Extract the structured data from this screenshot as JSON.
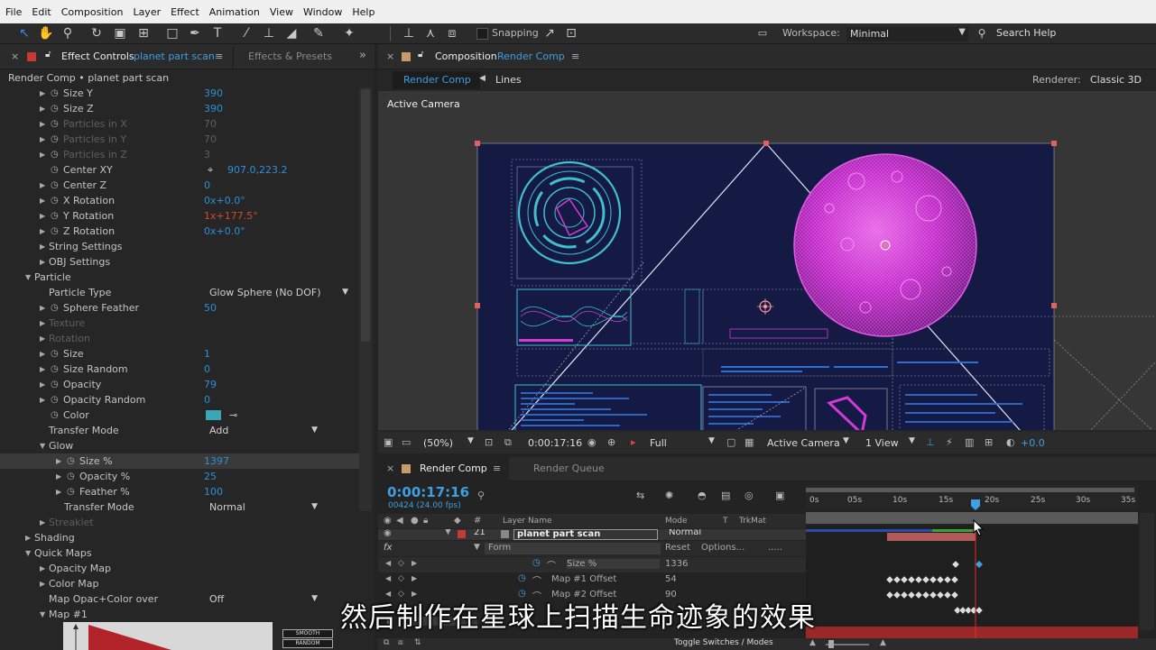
{
  "menu": [
    "File",
    "Edit",
    "Composition",
    "Layer",
    "Effect",
    "Animation",
    "View",
    "Window",
    "Help"
  ],
  "toolbar": {
    "snapping_label": "Snapping",
    "workspace_label": "Workspace:",
    "workspace_value": "Minimal",
    "search_help": "Search Help"
  },
  "effect_controls": {
    "tab_prefix": "Effect Controls",
    "layer_name": "planet part scan",
    "tab2": "Effects & Presets",
    "breadcrumb": "Render Comp • planet part scan",
    "rows": [
      {
        "label": "Size Y",
        "value": "390",
        "indent": 1,
        "tri": "▶",
        "sw": true,
        "state": "normal"
      },
      {
        "label": "Size Z",
        "value": "390",
        "indent": 1,
        "tri": "▶",
        "sw": true,
        "state": "normal"
      },
      {
        "label": "Particles in X",
        "value": "70",
        "indent": 1,
        "tri": "▶",
        "sw": true,
        "state": "dim"
      },
      {
        "label": "Particles in Y",
        "value": "70",
        "indent": 1,
        "tri": "▶",
        "sw": true,
        "state": "dim"
      },
      {
        "label": "Particles in Z",
        "value": "3",
        "indent": 1,
        "tri": "▶",
        "sw": true,
        "state": "dim"
      },
      {
        "label": "Center XY",
        "value": "907.0,223.2",
        "indent": 1,
        "tri": "",
        "sw": true,
        "state": "point"
      },
      {
        "label": "Center Z",
        "value": "0",
        "indent": 1,
        "tri": "▶",
        "sw": true,
        "state": "normal"
      },
      {
        "label": "X Rotation",
        "value": "0x+0.0°",
        "indent": 1,
        "tri": "▶",
        "sw": true,
        "state": "normal"
      },
      {
        "label": "Y Rotation",
        "value": "1x+177.5°",
        "indent": 1,
        "tri": "▶",
        "sw": true,
        "state": "red"
      },
      {
        "label": "Z Rotation",
        "value": "0x+0.0°",
        "indent": 1,
        "tri": "▶",
        "sw": true,
        "state": "normal"
      },
      {
        "label": "String Settings",
        "value": "",
        "indent": 1,
        "tri": "▶",
        "sw": false,
        "state": "normal"
      },
      {
        "label": "OBJ Settings",
        "value": "",
        "indent": 1,
        "tri": "▶",
        "sw": false,
        "state": "normal"
      },
      {
        "label": "Particle",
        "value": "",
        "indent": 0,
        "tri": "▼",
        "sw": false,
        "state": "normal"
      },
      {
        "label": "Particle Type",
        "value": "",
        "indent": 2,
        "tri": "",
        "sw": false,
        "state": "dd",
        "dd": "Glow Sphere (No DOF)"
      },
      {
        "label": "Sphere Feather",
        "value": "50",
        "indent": 1,
        "tri": "▶",
        "sw": true,
        "state": "normal"
      },
      {
        "label": "Texture",
        "value": "",
        "indent": 1,
        "tri": "▶",
        "sw": false,
        "state": "dim"
      },
      {
        "label": "Rotation",
        "value": "",
        "indent": 1,
        "tri": "▶",
        "sw": false,
        "state": "dim"
      },
      {
        "label": "Size",
        "value": "1",
        "indent": 1,
        "tri": "▶",
        "sw": true,
        "state": "normal"
      },
      {
        "label": "Size Random",
        "value": "0",
        "indent": 1,
        "tri": "▶",
        "sw": true,
        "state": "normal"
      },
      {
        "label": "Opacity",
        "value": "79",
        "indent": 1,
        "tri": "▶",
        "sw": true,
        "state": "normal"
      },
      {
        "label": "Opacity Random",
        "value": "0",
        "indent": 1,
        "tri": "▶",
        "sw": true,
        "state": "normal"
      },
      {
        "label": "Color",
        "value": "",
        "indent": 1,
        "tri": "",
        "sw": true,
        "state": "color"
      },
      {
        "label": "Transfer Mode",
        "value": "",
        "indent": 2,
        "tri": "",
        "sw": false,
        "state": "dd",
        "dd": "Add"
      },
      {
        "label": "Glow",
        "value": "",
        "indent": 1,
        "tri": "▼",
        "sw": false,
        "state": "normal"
      },
      {
        "label": "Size %",
        "value": "1397",
        "indent": 3,
        "tri": "▶",
        "sw": true,
        "state": "sel"
      },
      {
        "label": "Opacity %",
        "value": "25",
        "indent": 3,
        "tri": "▶",
        "sw": true,
        "state": "normal"
      },
      {
        "label": "Feather %",
        "value": "100",
        "indent": 3,
        "tri": "▶",
        "sw": true,
        "state": "normal"
      },
      {
        "label": "Transfer Mode",
        "value": "",
        "indent": 4,
        "tri": "",
        "sw": false,
        "state": "dd",
        "dd": "Normal"
      },
      {
        "label": "Streaklet",
        "value": "",
        "indent": 1,
        "tri": "▶",
        "sw": false,
        "state": "dim"
      },
      {
        "label": "Shading",
        "value": "",
        "indent": 0,
        "tri": "▶",
        "sw": false,
        "state": "normal"
      },
      {
        "label": "Quick Maps",
        "value": "",
        "indent": 0,
        "tri": "▼",
        "sw": false,
        "state": "normal"
      },
      {
        "label": "Opacity Map",
        "value": "",
        "indent": 1,
        "tri": "▶",
        "sw": false,
        "state": "normal"
      },
      {
        "label": "Color Map",
        "value": "",
        "indent": 1,
        "tri": "▶",
        "sw": false,
        "state": "normal"
      },
      {
        "label": "Map Opac+Color over",
        "value": "",
        "indent": 2,
        "tri": "",
        "sw": false,
        "state": "dd",
        "dd": "Off"
      },
      {
        "label": "Map #1",
        "value": "",
        "indent": 1,
        "tri": "▼",
        "sw": false,
        "state": "normal"
      }
    ],
    "smooth_label": "SMOOTH",
    "random_label": "RANDOM",
    "color_swatch": "#3aa7b8"
  },
  "composition": {
    "tab_prefix": "Composition",
    "comp_name": "Render Comp",
    "crumb_active": "Render Comp",
    "crumb_next": "Lines",
    "renderer_label": "Renderer:",
    "renderer_value": "Classic 3D",
    "view_label": "Active Camera",
    "zoom": "(50%)",
    "timecode": "0:00:17:16",
    "resolution": "Full",
    "camera": "Active Camera",
    "views": "1 View",
    "exposure": "+0.0"
  },
  "timeline": {
    "tab": "Render Comp",
    "tab2": "Render Queue",
    "timecode": "0:00:17:16",
    "frames": "00424 (24.00 fps)",
    "col_layer": "Layer Name",
    "col_mode": "Mode",
    "col_t": "T",
    "col_trkmat": "TrkMat",
    "layer_num": "21",
    "layer_name": "planet part scan",
    "layer_mode": "Normal",
    "effect_name": "Form",
    "reset": "Reset",
    "options": "Options...",
    "props": [
      {
        "name": "Size %",
        "value": "1336"
      },
      {
        "name": "Map #1 Offset",
        "value": "54"
      },
      {
        "name": "Map #2 Offset",
        "value": "90"
      }
    ],
    "ruler": [
      "0s",
      "05s",
      "10s",
      "15s",
      "20s",
      "25s",
      "30s",
      "35s"
    ],
    "footer": "Toggle Switches / Modes"
  },
  "subtitle": "然后制作在星球上扫描生命迹象的效果",
  "colors": {
    "accent": "#2d8fd7",
    "planet": "#d43ad8",
    "comp_bg": "#141a44",
    "playhead": "#e02a2a",
    "value": "#2d8fd7"
  }
}
